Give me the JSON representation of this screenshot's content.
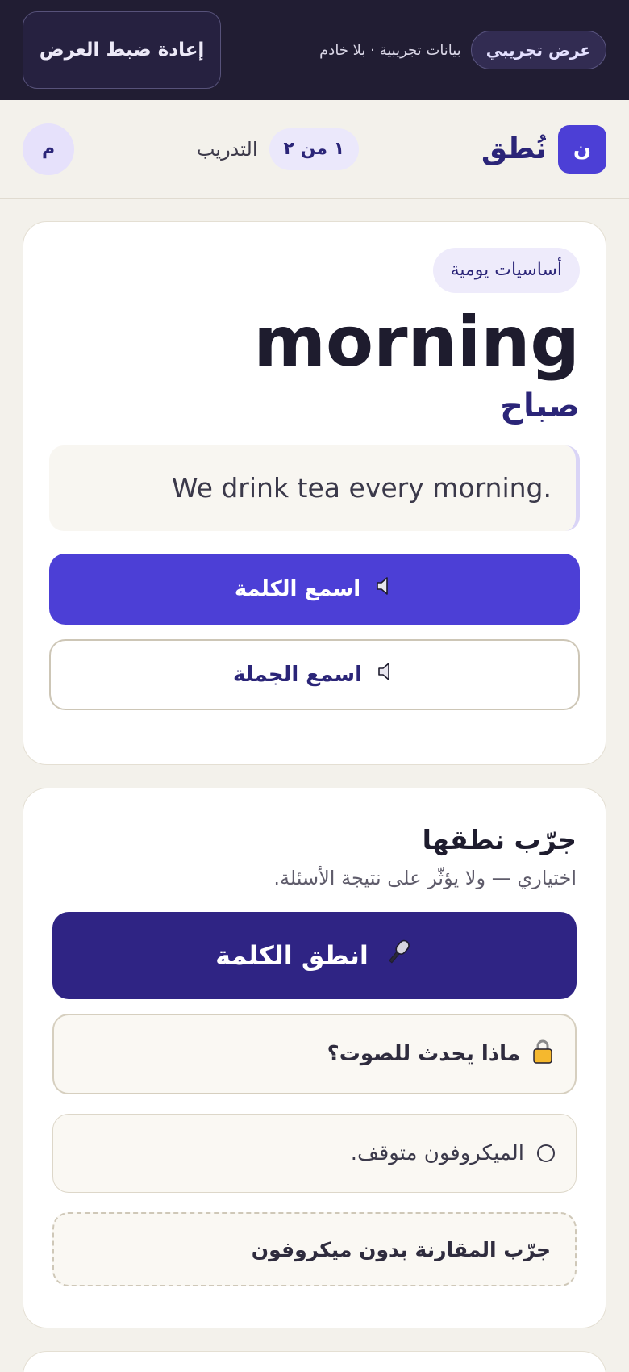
{
  "demo_bar": {
    "badge": "عرض تجريبي",
    "note": "بيانات تجريبية · بلا خادم",
    "reset_label": "إعادة ضبط العرض"
  },
  "header": {
    "logo_letter": "ن",
    "brand_name": "نُطق",
    "progress": "١ من ٢",
    "section": "التدريب",
    "avatar_letter": "م"
  },
  "word_card": {
    "category": "أساسيات يومية",
    "word": "morning",
    "translation": "صباح",
    "example": "We drink tea every morning.",
    "listen_word_label": "اسمع الكلمة",
    "listen_sentence_label": "اسمع الجملة",
    "icons": [
      "speaker-icon"
    ]
  },
  "practice_card": {
    "title": "جرّب نطقها",
    "subtitle": "اختياري — ولا يؤثّر على نتيجة الأسئلة.",
    "speak_label": "انطق الكلمة",
    "info_label": "ماذا يحدث للصوت؟",
    "status_text": "الميكروفون متوقف.",
    "compare_label": "جرّب المقارنة بدون ميكروفون",
    "icons": [
      "microphone-icon",
      "lock-icon",
      "status-circle-icon"
    ]
  },
  "colors": {
    "primary": "#4c3fd6",
    "primary_dark": "#2f2484",
    "top_bar": "#211d33",
    "background": "#f3f1eb"
  }
}
